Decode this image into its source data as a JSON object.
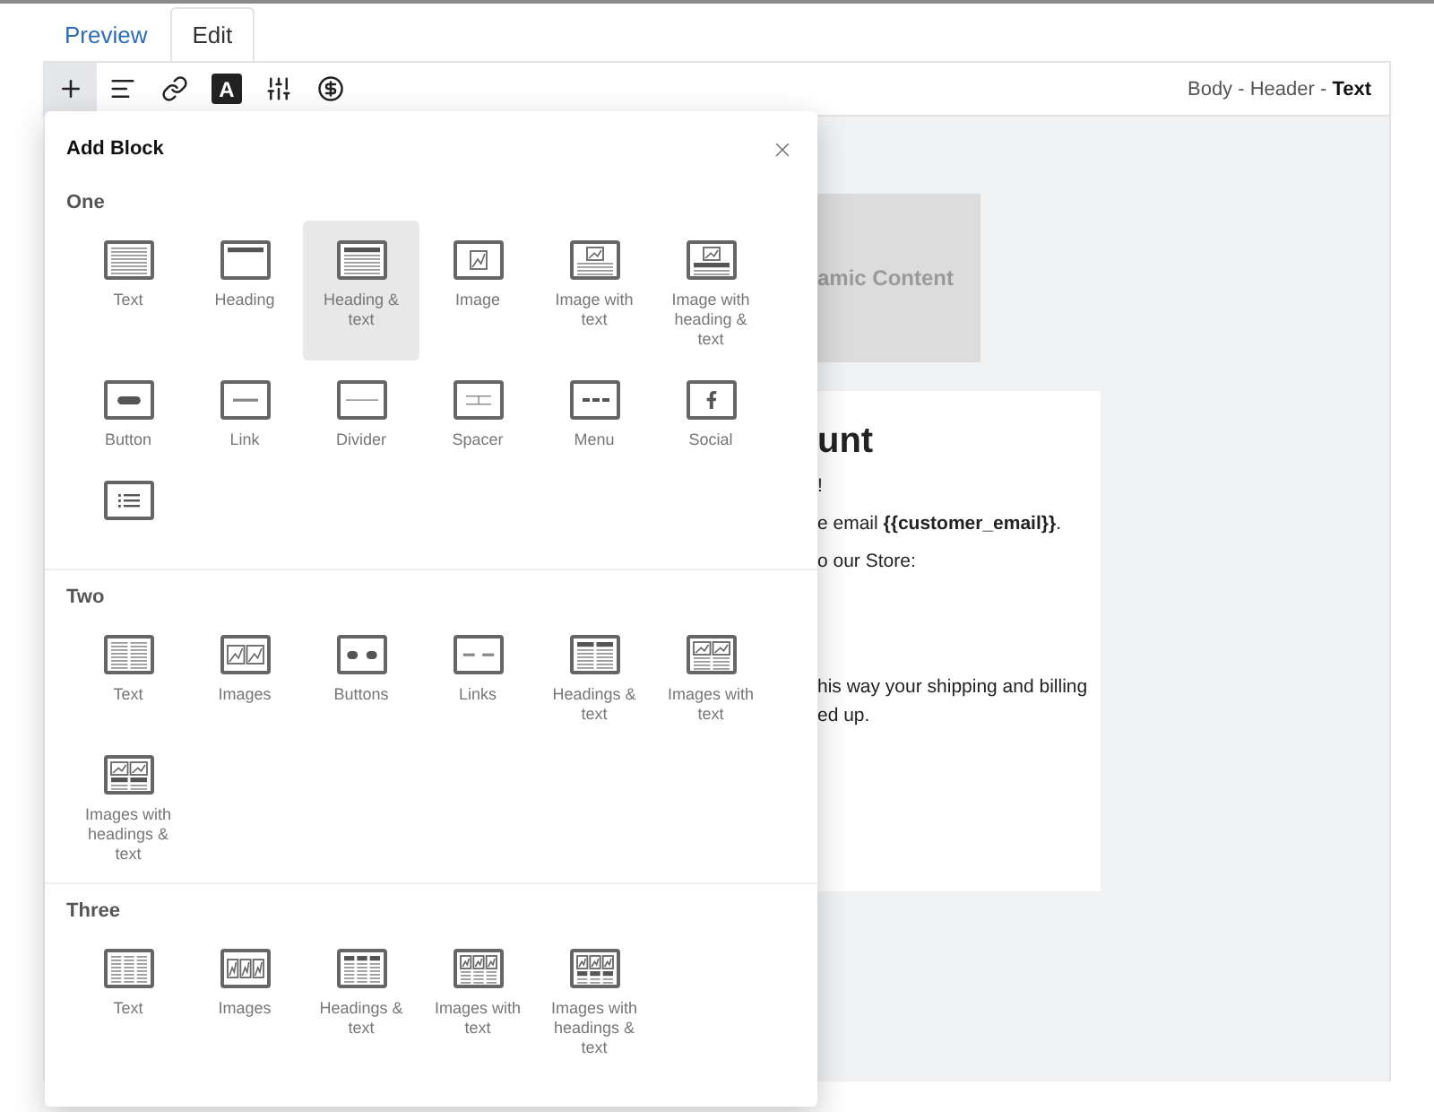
{
  "tabs": [
    {
      "label": "Preview",
      "selected": false
    },
    {
      "label": "Edit",
      "selected": true
    }
  ],
  "toolbar": {
    "buttons": [
      {
        "selected": true,
        "active": false
      },
      {
        "selected": false,
        "active": false
      },
      {
        "selected": false,
        "active": false
      },
      {
        "label": "A",
        "selected": false,
        "active": true
      },
      {
        "selected": false,
        "active": false
      },
      {
        "selected": false,
        "active": false
      }
    ],
    "breadcrumb": "Body - Header - **Text**"
  },
  "add_block": {
    "title": "Add Block",
    "sections": [
      {
        "title": "One",
        "items": [
          {
            "label": "Text",
            "selected": false
          },
          {
            "label": "Heading",
            "selected": false
          },
          {
            "label": "Heading & text",
            "selected": true
          },
          {
            "label": "Image",
            "selected": false
          },
          {
            "label": "Image with text",
            "selected": false
          },
          {
            "label": "Image with heading & text",
            "selected": false
          },
          {
            "label": "Button",
            "selected": false
          },
          {
            "label": "Link",
            "selected": false
          },
          {
            "label": "Divider",
            "selected": false
          },
          {
            "label": "Spacer",
            "selected": false
          },
          {
            "label": "Menu",
            "selected": false
          },
          {
            "label": "Social",
            "selected": false
          },
          {
            "selected": false
          }
        ]
      },
      {
        "title": "Two",
        "items": [
          {
            "label": "Text",
            "selected": false
          },
          {
            "label": "Images",
            "selected": false
          },
          {
            "label": "Buttons",
            "selected": false
          },
          {
            "label": "Links",
            "selected": false
          },
          {
            "label": "Headings & text",
            "selected": false
          },
          {
            "label": "Images with text",
            "selected": false
          },
          {
            "label": "Images with headings & text",
            "selected": false
          }
        ]
      },
      {
        "title": "Three",
        "items": [
          {
            "label": "Text",
            "selected": false
          },
          {
            "label": "Images",
            "selected": false
          },
          {
            "label": "Headings & text",
            "selected": false
          },
          {
            "label": "Images with text",
            "selected": false
          },
          {
            "label": "Images with headings & text",
            "selected": false
          }
        ]
      }
    ]
  },
  "canvas": {
    "placeholder": "amic Content",
    "email": {
      "heading": "unt",
      "paragraphs": [
        {
          "lines": [
            "!"
          ]
        },
        {
          "lines": [
            "e email **{{customer_email}}**."
          ]
        },
        {
          "lines": [
            "o our Store:"
          ]
        },
        {
          "lines": [
            "his way your shipping and billing",
            "ed up."
          ]
        }
      ]
    }
  }
}
